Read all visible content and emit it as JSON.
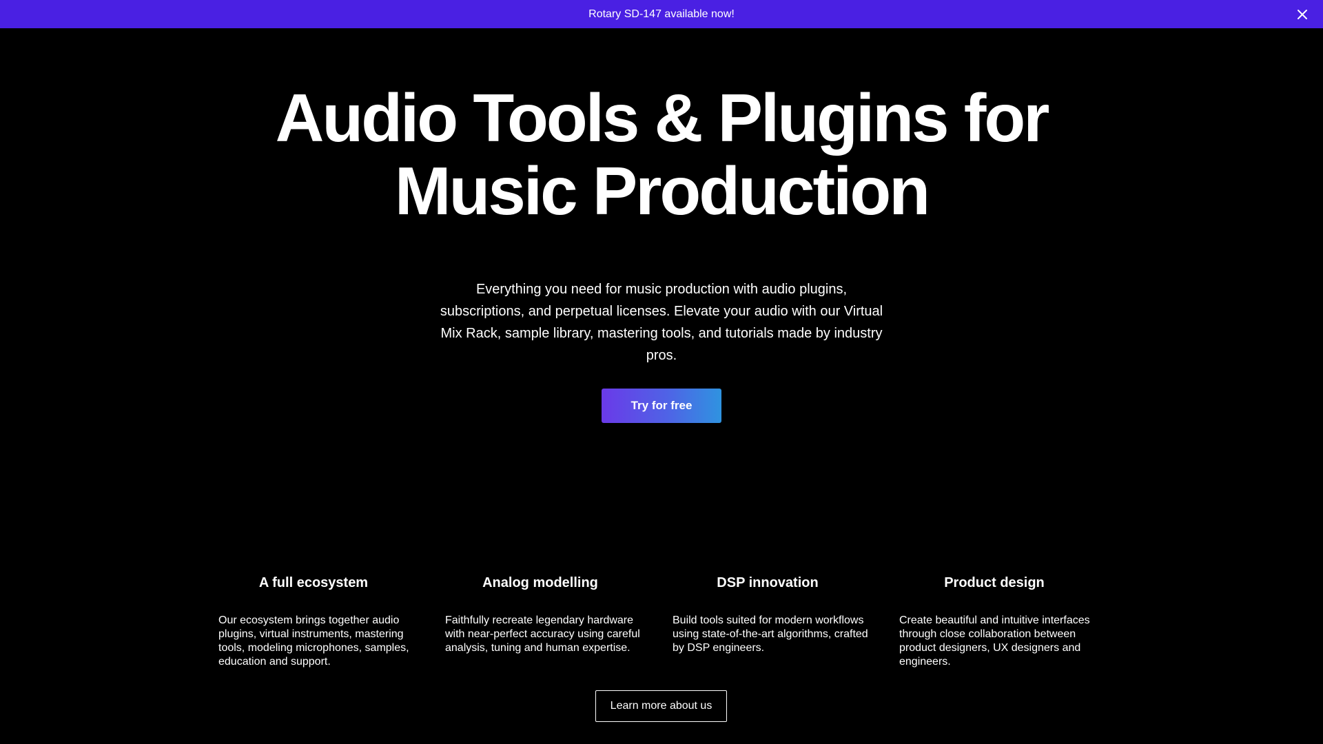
{
  "banner": {
    "text": "Rotary SD-147 available now!",
    "close_icon": "close-icon",
    "background": "#4a20e3"
  },
  "hero": {
    "title": "Audio Tools & Plugins for Music Production",
    "subtitle": "Everything you need for music production with audio plugins, subscriptions, and perpetual licenses. Elevate your audio with our Virtual Mix Rack, sample library, mastering tools, and tutorials made by industry pros.",
    "cta_label": "Try for free",
    "cta_gradient": [
      "#6a3ae8",
      "#2f93e0"
    ]
  },
  "features": [
    {
      "title": "A full ecosystem",
      "description": "Our ecosystem brings together audio plugins, virtual instruments, mastering tools, modeling microphones, samples, education and support."
    },
    {
      "title": "Analog modelling",
      "description": "Faithfully recreate legendary hardware with near-perfect accuracy using careful analysis, tuning and human expertise."
    },
    {
      "title": "DSP innovation",
      "description": "Build tools suited for modern workflows using state-of-the-art algorithms, crafted by DSP engineers."
    },
    {
      "title": "Product design",
      "description": "Create beautiful and intuitive interfaces through close collaboration between product designers, UX designers and engineers."
    }
  ],
  "learn_more_label": "Learn more about us",
  "colors": {
    "background": "#000000",
    "text": "#ffffff"
  }
}
